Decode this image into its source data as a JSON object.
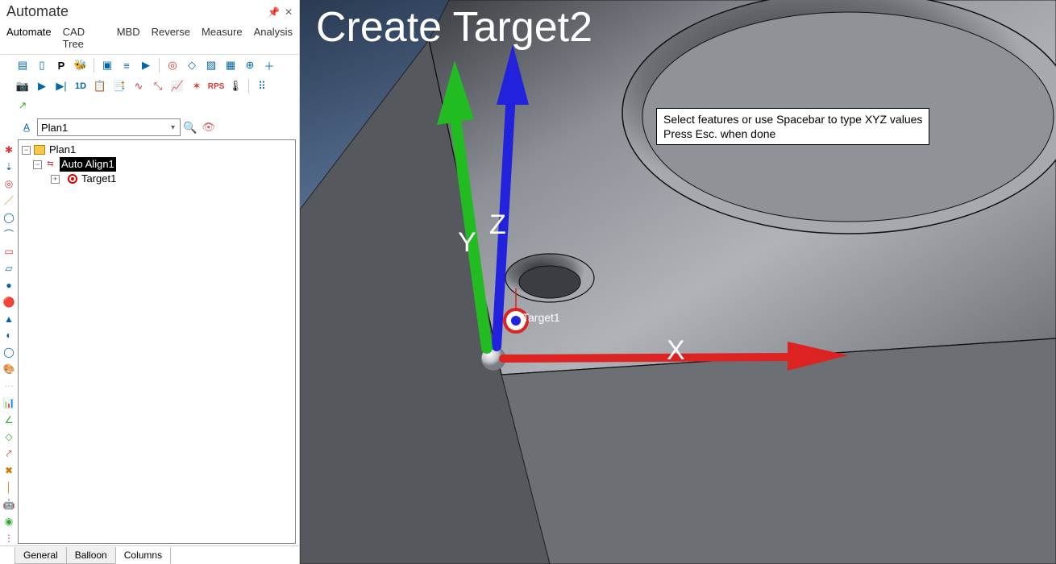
{
  "panel": {
    "title": "Automate",
    "tabs": [
      "Automate",
      "CAD Tree",
      "MBD",
      "Reverse",
      "Measure",
      "Analysis"
    ],
    "activeTab": 0,
    "searchValue": "Plan1",
    "bottomTabs": [
      "General",
      "Balloon",
      "Columns"
    ],
    "activeBottomTab": 2
  },
  "toolbarRow1": [
    "list",
    "doc",
    "P",
    "probe",
    "page",
    "lines",
    "play",
    "sep",
    "target",
    "tag",
    "hatch",
    "pattern",
    "aim",
    "plus"
  ],
  "toolbarRow2": [
    "cam",
    "play2",
    "next",
    "1D",
    "log",
    "clip",
    "curve",
    "xy",
    "graph",
    "point",
    "RPS",
    "temp",
    "sep",
    "grid",
    "arrow"
  ],
  "tree": {
    "root": {
      "label": "Plan1"
    },
    "child1": {
      "label": "Auto Align1"
    },
    "child2": {
      "label": "Target1"
    }
  },
  "viewport": {
    "title": "Create Target2",
    "hintLine1": "Select features or use Spacebar to type XYZ values",
    "hintLine2": "Press Esc. when done",
    "axisX": "X",
    "axisY": "Y",
    "axisZ": "Z",
    "target1Label": "Target1"
  }
}
